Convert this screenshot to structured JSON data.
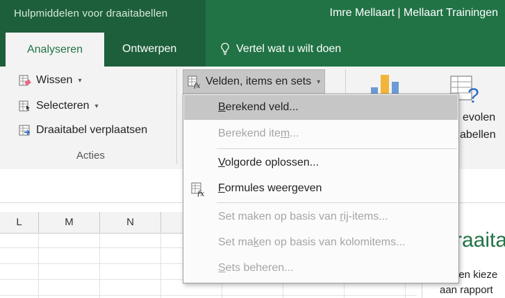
{
  "titlebar": {
    "context_label": "Hulpmiddelen voor draaitabellen",
    "user_label": "Imre Mellaart | Mellaart Trainingen"
  },
  "tabs": {
    "active": "Analyseren",
    "design": "Ontwerpen",
    "tell_me": "Vertel wat u wilt doen"
  },
  "ribbon": {
    "actions": {
      "clear": "Wissen",
      "select": "Selecteren",
      "move": "Draaitabel verplaatsen",
      "group_label": "Acties"
    },
    "calculations": {
      "fields_items_sets": "Velden, items en sets"
    },
    "right_fragments": {
      "recommended_1": "evolen",
      "recommended_2": "abellen"
    }
  },
  "menu": {
    "items": [
      {
        "pre": "",
        "u": "B",
        "post": "erekend veld...",
        "enabled": true,
        "highlighted": true
      },
      {
        "pre": "Berekend ite",
        "u": "m",
        "post": "...",
        "enabled": false
      },
      {
        "pre": "",
        "u": "V",
        "post": "olgorde oplossen...",
        "enabled": true
      },
      {
        "pre": "",
        "u": "F",
        "post": "ormules weergeven",
        "enabled": true
      },
      {
        "pre": "Set maken op basis van ",
        "u": "r",
        "post": "ij-items...",
        "enabled": false
      },
      {
        "pre": "Set ma",
        "u": "k",
        "post": "en op basis van kolomitems...",
        "enabled": false
      },
      {
        "pre": "",
        "u": "S",
        "post": "ets beheren...",
        "enabled": false
      }
    ]
  },
  "sheet": {
    "columns": [
      "L",
      "M",
      "N"
    ]
  },
  "taskpane": {
    "title_fragment": "raaita",
    "text1": "den kieze",
    "text2": "aan rapport"
  },
  "colors": {
    "excel_green": "#217346",
    "contextual_green": "#1e5f3b",
    "highlight": "#c6c6c6",
    "disabled": "#a5a5a5"
  }
}
